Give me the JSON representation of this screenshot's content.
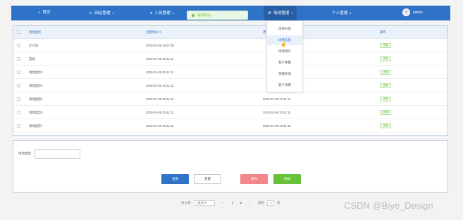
{
  "topnav": {
    "items": [
      {
        "label": "首页",
        "icon": "home-icon"
      },
      {
        "label": "网站管理",
        "icon": "monitor-icon"
      },
      {
        "label": "人员管理",
        "icon": "user-icon"
      },
      {
        "label": "场地管理",
        "icon": "settings-icon"
      },
      {
        "label": "个人管理",
        "icon": "person-icon"
      }
    ],
    "user": "admin",
    "accent": "#2f73c8"
  },
  "toast": {
    "message": "操作成功!"
  },
  "dropdown": {
    "items": [
      "场地分类",
      "场地信息",
      "场地预订",
      "客户余额",
      "余额充值",
      "客户消费"
    ],
    "hovered": "场地信息"
  },
  "table": {
    "headers": [
      "场地类型",
      "创建时间",
      "更新时间",
      "操作"
    ],
    "rows": [
      {
        "type": "乒乓球",
        "created": "2023-02-05 10:57:39",
        "updated": "",
        "action": "详情"
      },
      {
        "type": "篮球",
        "created": "2023-02-05 10:41:11",
        "updated": "",
        "action": "详情"
      },
      {
        "type": "场地类型3",
        "created": "2023-02-05 10:41:11",
        "updated": "",
        "action": "详情"
      },
      {
        "type": "场地类型4",
        "created": "2023-02-05 10:41:11",
        "updated": "",
        "action": "详情"
      },
      {
        "type": "场地类型5",
        "created": "2023-02-05 10:41:11",
        "updated": "2023-02-05 10:41:11",
        "action": "详情"
      },
      {
        "type": "场地类型6",
        "created": "2023-02-05 10:41:11",
        "updated": "2023-02-05 10:41:11",
        "action": "详情"
      },
      {
        "type": "场地类型7",
        "created": "2023-02-05 10:41:11",
        "updated": "2023-02-05 10:41:11",
        "action": "详情"
      }
    ]
  },
  "search": {
    "label": "场地类型",
    "value": ""
  },
  "buttons": {
    "query": "查询",
    "reset": "重置",
    "delete": "删除",
    "add": "添加"
  },
  "pagination": {
    "total": "共 8 条",
    "page_size": "7条/页",
    "prev": "‹",
    "pages": [
      "1",
      "2"
    ],
    "current": "2",
    "next": "›",
    "goto_label": "前往",
    "goto_value": "1",
    "page_suffix": "页"
  },
  "watermark": "CSDN @Biye_Design"
}
